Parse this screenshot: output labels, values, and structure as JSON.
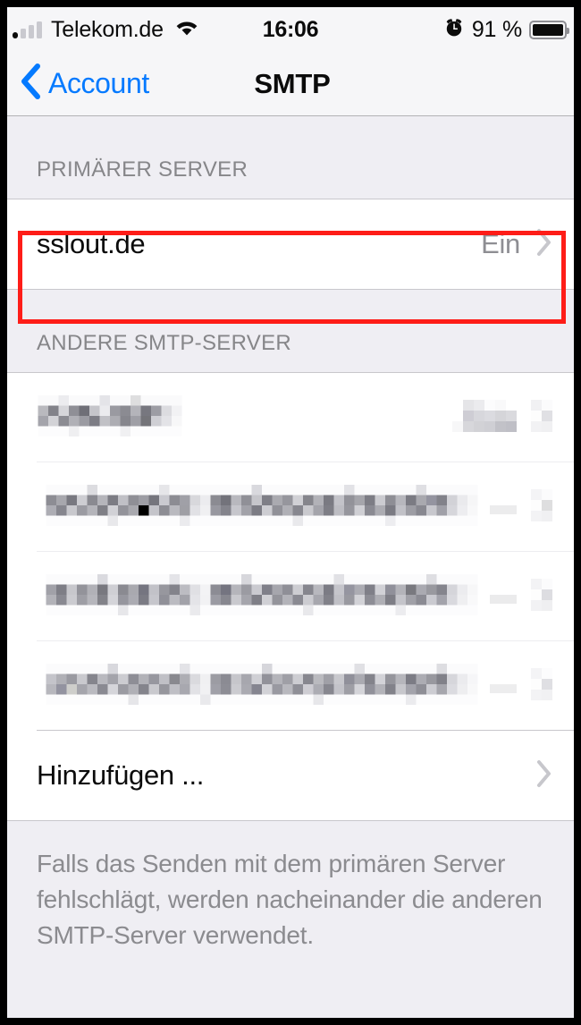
{
  "status_bar": {
    "carrier": "Telekom.de",
    "signal_icon": "cellular-signal-icon",
    "signal_bars_active": 1,
    "signal_bars_total": 4,
    "wifi_icon": "wifi-icon",
    "time": "16:06",
    "alarm_icon": "alarm-clock-icon",
    "battery_percent": "91 %",
    "battery_icon": "battery-full-icon",
    "background": "#f6f6f8"
  },
  "nav_bar": {
    "back_icon": "chevron-left-icon",
    "back_label": "Account",
    "title": "SMTP",
    "tint_color": "#057aff"
  },
  "sections": {
    "primary": {
      "header": "PRIMÄRER SERVER",
      "rows": [
        {
          "title": "sslout.de",
          "value": "Ein",
          "accessory_icon": "chevron-right-icon",
          "highlighted": true
        }
      ]
    },
    "other": {
      "header": "ANDERE SMTP-SERVER",
      "rows": [
        {
          "title": "",
          "value": "",
          "redacted": true,
          "title_width": 160,
          "value_width": 68,
          "accessory_icon": "chevron-right-icon"
        },
        {
          "title": "",
          "value": "",
          "redacted": true,
          "title_width": 500,
          "value_width": 30,
          "accessory_icon": "chevron-right-icon"
        },
        {
          "title": "",
          "value": "",
          "redacted": true,
          "title_width": 500,
          "value_width": 30,
          "accessory_icon": "chevron-right-icon"
        },
        {
          "title": "",
          "value": "",
          "redacted": true,
          "title_width": 500,
          "value_width": 30,
          "accessory_icon": "chevron-right-icon"
        }
      ],
      "add_row": {
        "title": "Hinzufügen ...",
        "accessory_icon": "chevron-right-icon"
      }
    }
  },
  "footer": {
    "note": "Falls das Senden mit dem primären Server fehlschlägt, werden nacheinander die anderen SMTP-Server verwendet."
  },
  "annotation": {
    "type": "rectangle-highlight",
    "color": "#fe1d18",
    "target": "sslout.de primary server row"
  },
  "colors": {
    "grouped_background": "#efeef3",
    "cell_background": "#ffffff",
    "separator": "#c8c7cc",
    "secondary_text": "#8e8e93",
    "header_text": "#868689",
    "device_frame": "#000000"
  }
}
